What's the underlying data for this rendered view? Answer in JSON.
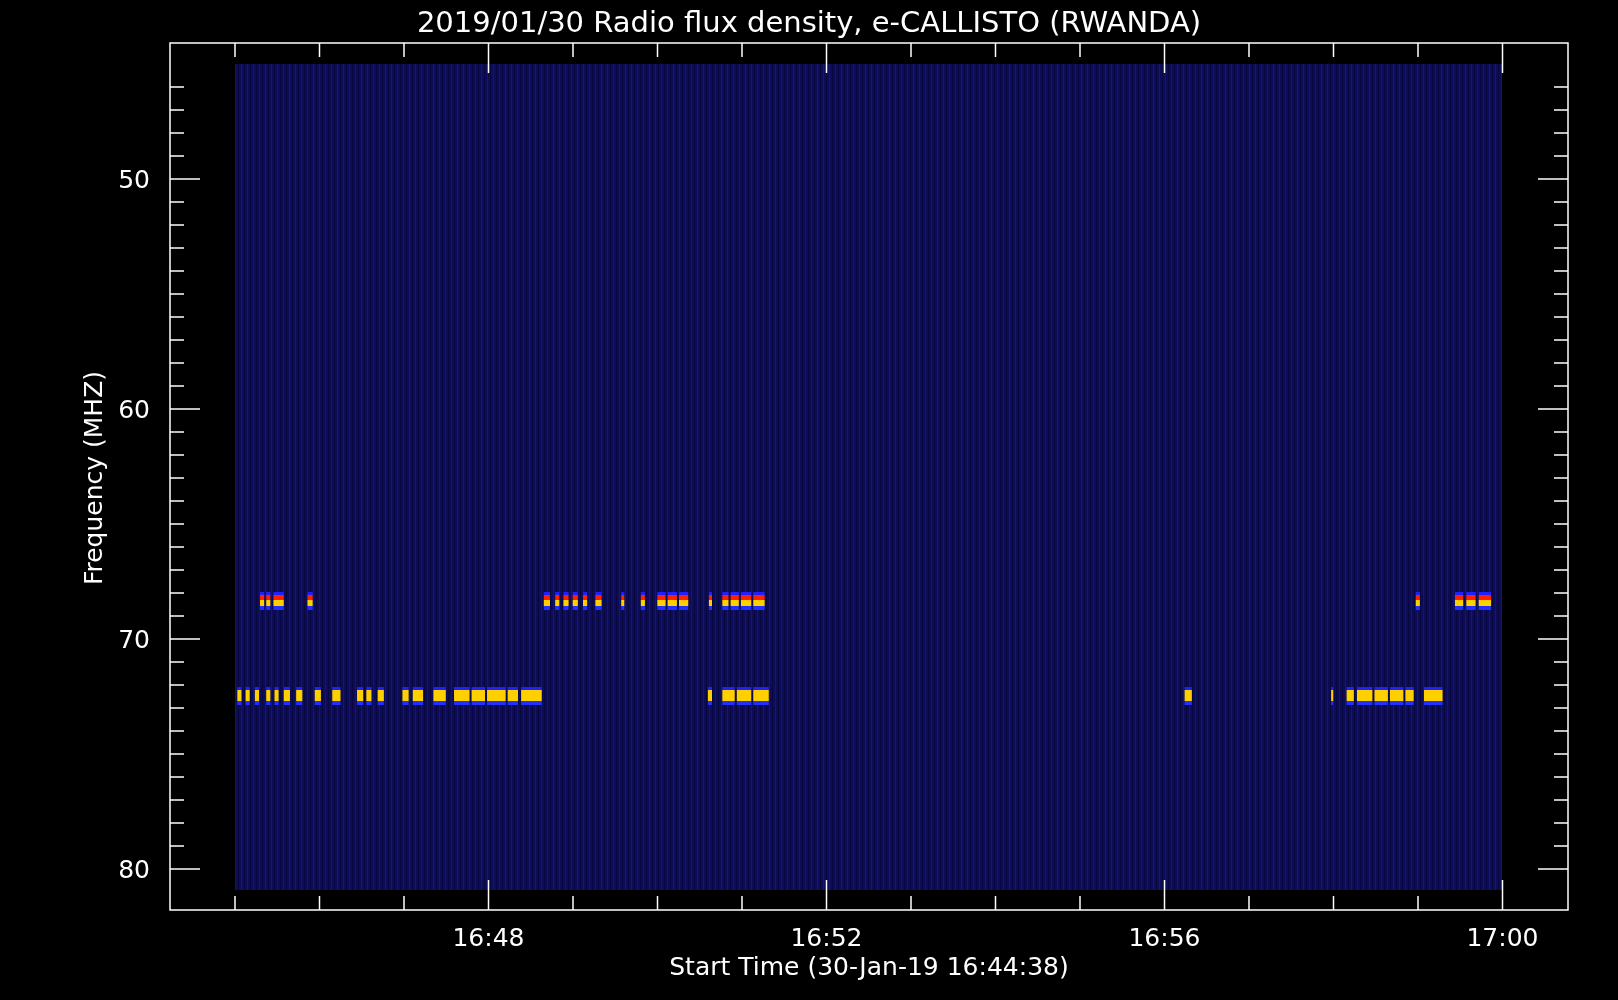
{
  "title": "2019/01/30  Radio flux density, e-CALLISTO (RWANDA)",
  "x_axis": {
    "label": "Start Time (30-Jan-19 16:44:38)",
    "ticks": [
      "16:48",
      "16:52",
      "16:56",
      "17:00"
    ]
  },
  "y_axis": {
    "label": "Frequency (MHZ)",
    "ticks": [
      "50",
      "60",
      "70",
      "80"
    ]
  }
}
